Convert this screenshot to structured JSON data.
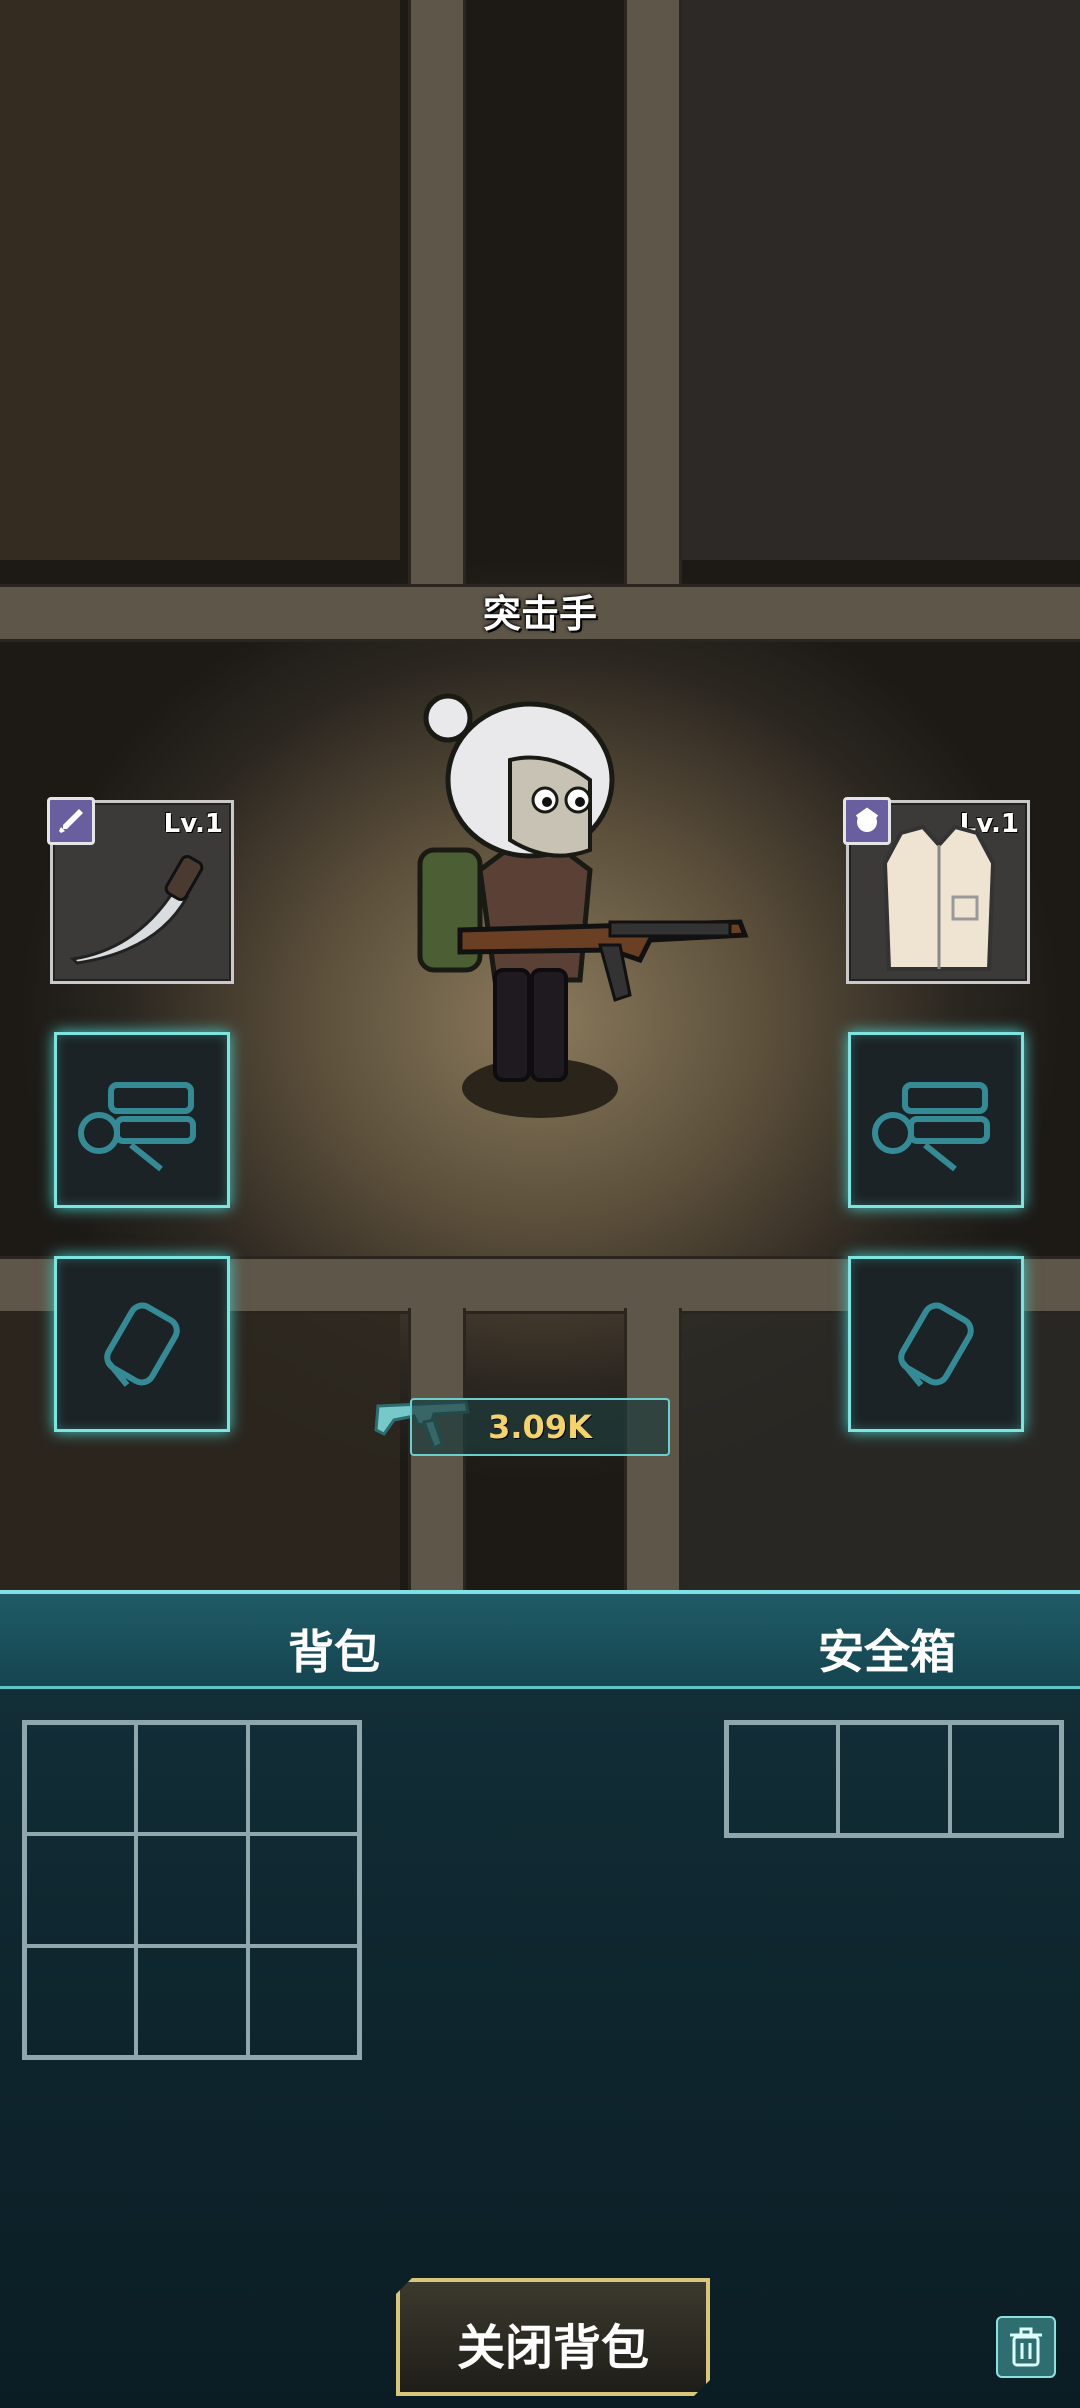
{
  "character": {
    "role": "突击手"
  },
  "equipment": {
    "weapon": {
      "level": "Lv.1",
      "item_icon": "combat-knife-icon",
      "badge_icon": "sword-icon"
    },
    "armor": {
      "level": "Lv.1",
      "item_icon": "vest-icon",
      "badge_icon": "armor-icon"
    }
  },
  "mod_slots": {
    "count": 4,
    "types": [
      "gun-parts",
      "gun-parts",
      "bullet-canister",
      "bullet-canister"
    ]
  },
  "weapon_value": {
    "icon": "rifle-icon",
    "value": "3.09K"
  },
  "inventory": {
    "backpack": {
      "title": "背包",
      "rows": 3,
      "cols": 3
    },
    "safe_box": {
      "title": "安全箱",
      "rows": 1,
      "cols": 3
    }
  },
  "actions": {
    "close_label": "关闭背包",
    "trash_icon": "trash-icon"
  },
  "colors": {
    "accent": "#7ee4e0",
    "gold": "#f4d46a",
    "panel": "#0f2730"
  }
}
